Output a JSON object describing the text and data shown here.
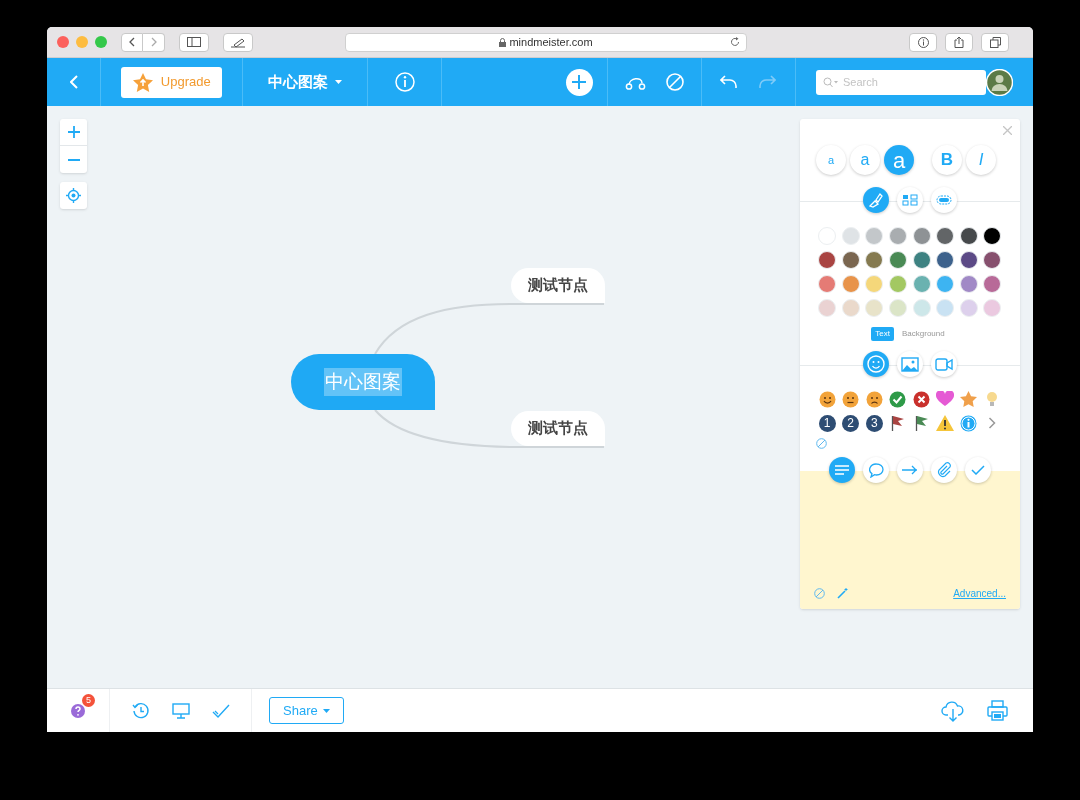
{
  "browser": {
    "url": "mindmeister.com"
  },
  "toolbar": {
    "upgrade": "Upgrade",
    "map_title": "中心图案",
    "search_placeholder": "Search"
  },
  "map": {
    "root": "中心图案",
    "root_selected": true,
    "children": [
      {
        "label": "测试节点"
      },
      {
        "label": "测试节点"
      }
    ]
  },
  "panel": {
    "font_sizes": [
      {
        "label": "a",
        "selected": false
      },
      {
        "label": "a",
        "selected": false
      },
      {
        "label": "a",
        "selected": true
      }
    ],
    "styles": [
      {
        "label": "B"
      },
      {
        "label": "I"
      }
    ],
    "style_tabs": [
      {
        "kind": "brush",
        "selected": true
      },
      {
        "kind": "layout",
        "selected": false
      },
      {
        "kind": "shape",
        "selected": false
      }
    ],
    "colors": [
      {
        "color": "#ffffff"
      },
      {
        "color": "#dfe3e6"
      },
      {
        "color": "#c3c7ca"
      },
      {
        "color": "#a9adb0"
      },
      {
        "color": "#8e9295"
      },
      {
        "color": "#626567"
      },
      {
        "color": "#46494b"
      },
      {
        "color": "#000000"
      },
      {
        "color": "#a94442"
      },
      {
        "color": "#7a6650"
      },
      {
        "color": "#857a50"
      },
      {
        "color": "#4a8a55"
      },
      {
        "color": "#3e8282"
      },
      {
        "color": "#3d628c"
      },
      {
        "color": "#5c4a86"
      },
      {
        "color": "#87506e"
      },
      {
        "color": "#e57b75"
      },
      {
        "color": "#e8934a"
      },
      {
        "color": "#f5d77a"
      },
      {
        "color": "#a3c862"
      },
      {
        "color": "#6ab2b0"
      },
      {
        "color": "#3db4f2"
      },
      {
        "color": "#a189c6"
      },
      {
        "color": "#b86a98"
      },
      {
        "color": "#ead2d2"
      },
      {
        "color": "#ead9cb"
      },
      {
        "color": "#e8e3c9"
      },
      {
        "color": "#dbe5c7"
      },
      {
        "color": "#cde7e9"
      },
      {
        "color": "#c9e2f3"
      },
      {
        "color": "#ddd0ec"
      },
      {
        "color": "#ebc9e0"
      }
    ],
    "color_targets": [
      {
        "label": "Text",
        "selected": true
      },
      {
        "label": "Background",
        "selected": false
      }
    ],
    "media_tabs": [
      {
        "kind": "emoji",
        "selected": true
      },
      {
        "kind": "image",
        "selected": false
      },
      {
        "kind": "video",
        "selected": false
      }
    ],
    "icons": [
      {
        "kind": "happy"
      },
      {
        "kind": "neutral"
      },
      {
        "kind": "sad"
      },
      {
        "kind": "check"
      },
      {
        "kind": "cross"
      },
      {
        "kind": "heart"
      },
      {
        "kind": "star"
      },
      {
        "kind": "bulb"
      },
      {
        "kind": "number",
        "label": "1"
      },
      {
        "kind": "number",
        "label": "2"
      },
      {
        "kind": "number",
        "label": "3"
      },
      {
        "kind": "flag",
        "color": "#a94442"
      },
      {
        "kind": "flag",
        "color": "#4a8a55"
      },
      {
        "kind": "warning"
      },
      {
        "kind": "info"
      },
      {
        "kind": "more"
      }
    ],
    "note_tabs": [
      {
        "kind": "notes",
        "selected": true
      },
      {
        "kind": "comment",
        "selected": false
      },
      {
        "kind": "link",
        "selected": false
      },
      {
        "kind": "attachment",
        "selected": false
      },
      {
        "kind": "task",
        "selected": false
      }
    ],
    "advanced": "Advanced..."
  },
  "bottom": {
    "help_badge": "5",
    "share": "Share"
  }
}
